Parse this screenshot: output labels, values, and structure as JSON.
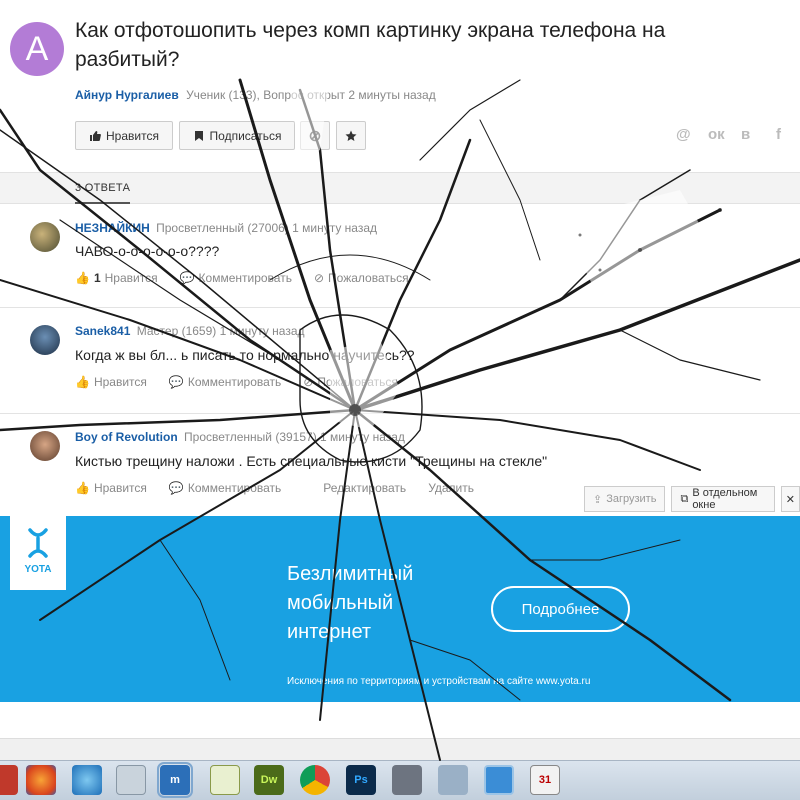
{
  "question": {
    "avatar_letter": "A",
    "title": "Как отфотошопить через комп картинку экрана телефона на разбитый?",
    "author": "Айнур Нургалиев",
    "meta": "Ученик (133), Вопрос открыт 2 минуты назад",
    "like_label": "Нравится",
    "subscribe_label": "Подписаться"
  },
  "share": [
    "@",
    "ок",
    "в",
    "f"
  ],
  "answers_count_label": "3 ОТВЕТА",
  "answers": [
    {
      "name": "НЕЗНАЙКИН",
      "meta": "Просветленный (27006) 1 минуту назад",
      "text": "ЧАВО-о-о-о-о-о-о????",
      "likes": "1",
      "like_label": "Нравится",
      "comment_label": "Комментировать",
      "report_label": "Пожаловаться"
    },
    {
      "name": "Sanek841",
      "meta": "Мастер (1659) 1 минуту назад",
      "text": "Когда ж вы бл... ь писать то нормально научитесь??",
      "like_label": "Нравится",
      "comment_label": "Комментировать",
      "report_label": "Пожаловаться"
    },
    {
      "name": "Boy of Revolution",
      "meta": "Просветленный (39157) 1 минуту назад",
      "text": "Кистью трещину наложи . Есть специальные кисти \"Трещины на стекле\"",
      "like_label": "Нравится",
      "comment_label": "Комментировать",
      "edit_label": "Редактировать",
      "delete_label": "Удалить"
    }
  ],
  "right_buttons": {
    "upload": "Загрузить",
    "separate_window": "В отдельном окне"
  },
  "ad": {
    "brand": "YOTA",
    "headline": "Безлимитный мобильный интернет",
    "button": "Подробнее",
    "disclaimer": "Исключения по территориям и устройствам на сайте www.yota.ru",
    "color": "#19a1e2"
  },
  "taskbar": {
    "apps": [
      "firefox",
      "internet-explorer",
      "calculator",
      "maxthon",
      "notepad",
      "dreamweaver",
      "chrome",
      "photoshop",
      "recorder",
      "network",
      "monitor",
      "calendar"
    ],
    "dw_label": "Dw",
    "ps_label": "Ps",
    "calendar_day": "31"
  }
}
